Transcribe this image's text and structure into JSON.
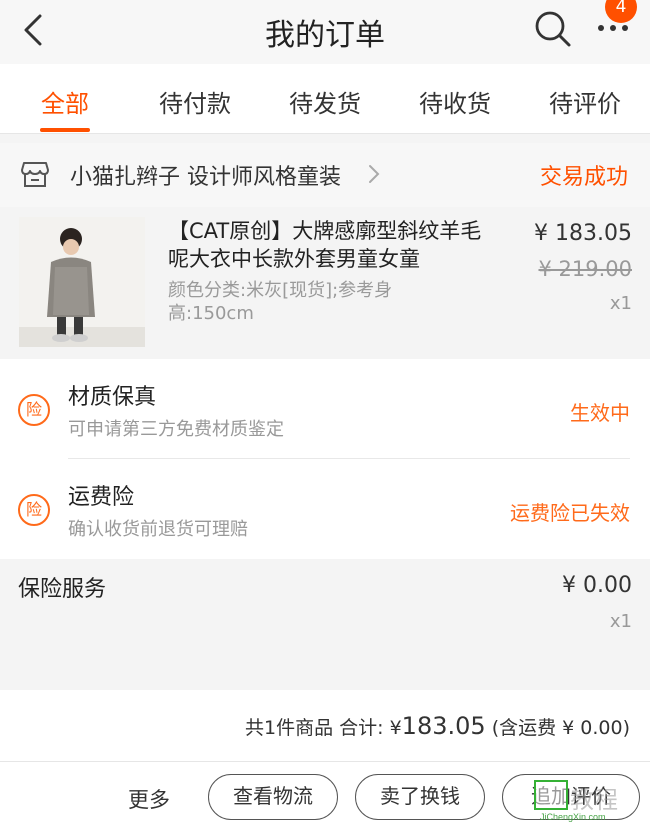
{
  "header": {
    "title": "我的订单",
    "badge_count": "4",
    "icons": [
      "back-icon",
      "search-icon",
      "more-icon"
    ]
  },
  "tabs": [
    {
      "label": "全部",
      "active": true
    },
    {
      "label": "待付款",
      "active": false
    },
    {
      "label": "待发货",
      "active": false
    },
    {
      "label": "待收货",
      "active": false
    },
    {
      "label": "待评价",
      "active": false
    }
  ],
  "shop": {
    "name": "小猫扎辫子 设计师风格童装",
    "status": "交易成功"
  },
  "product": {
    "title": "【CAT原创】大牌感廓型斜纹羊毛呢大衣中长款外套男童女童",
    "spec": "颜色分类:米灰[现货];参考身高:150cm",
    "price": "¥ 183.05",
    "original_price": "¥ 219.00",
    "quantity": "x1"
  },
  "insurance": [
    {
      "icon_text": "险",
      "name": "材质保真",
      "desc": "可申请第三方免费材质鉴定",
      "status": "生效中"
    },
    {
      "icon_text": "险",
      "name": "运费险",
      "desc": "确认收货前退货可理赔",
      "status": "运费险已失效"
    }
  ],
  "service": {
    "name": "保险服务",
    "price": "¥ 0.00",
    "quantity": "x1"
  },
  "total": {
    "prefix": "共1件商品 合计: ¥",
    "amount": "183.05",
    "suffix": " (含运费 ¥ 0.00)"
  },
  "bottom_bar": {
    "more": "更多",
    "buttons": [
      "查看物流",
      "卖了换钱",
      "追加评价"
    ]
  },
  "watermark": {
    "text": "教程",
    "url": "JiChengXin.com"
  },
  "colors": {
    "accent": "#ff5000",
    "insurance": "#ff6a1a"
  }
}
